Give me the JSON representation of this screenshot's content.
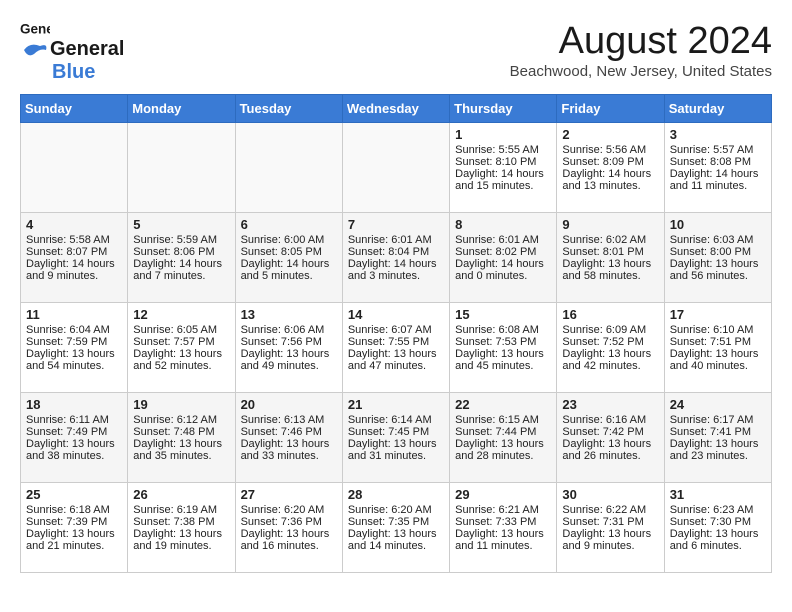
{
  "header": {
    "logo_general": "General",
    "logo_blue": "Blue",
    "month_title": "August 2024",
    "location": "Beachwood, New Jersey, United States"
  },
  "days_of_week": [
    "Sunday",
    "Monday",
    "Tuesday",
    "Wednesday",
    "Thursday",
    "Friday",
    "Saturday"
  ],
  "weeks": [
    [
      {
        "day": "",
        "content": ""
      },
      {
        "day": "",
        "content": ""
      },
      {
        "day": "",
        "content": ""
      },
      {
        "day": "",
        "content": ""
      },
      {
        "day": "1",
        "content": "Sunrise: 5:55 AM\nSunset: 8:10 PM\nDaylight: 14 hours\nand 15 minutes."
      },
      {
        "day": "2",
        "content": "Sunrise: 5:56 AM\nSunset: 8:09 PM\nDaylight: 14 hours\nand 13 minutes."
      },
      {
        "day": "3",
        "content": "Sunrise: 5:57 AM\nSunset: 8:08 PM\nDaylight: 14 hours\nand 11 minutes."
      }
    ],
    [
      {
        "day": "4",
        "content": "Sunrise: 5:58 AM\nSunset: 8:07 PM\nDaylight: 14 hours\nand 9 minutes."
      },
      {
        "day": "5",
        "content": "Sunrise: 5:59 AM\nSunset: 8:06 PM\nDaylight: 14 hours\nand 7 minutes."
      },
      {
        "day": "6",
        "content": "Sunrise: 6:00 AM\nSunset: 8:05 PM\nDaylight: 14 hours\nand 5 minutes."
      },
      {
        "day": "7",
        "content": "Sunrise: 6:01 AM\nSunset: 8:04 PM\nDaylight: 14 hours\nand 3 minutes."
      },
      {
        "day": "8",
        "content": "Sunrise: 6:01 AM\nSunset: 8:02 PM\nDaylight: 14 hours\nand 0 minutes."
      },
      {
        "day": "9",
        "content": "Sunrise: 6:02 AM\nSunset: 8:01 PM\nDaylight: 13 hours\nand 58 minutes."
      },
      {
        "day": "10",
        "content": "Sunrise: 6:03 AM\nSunset: 8:00 PM\nDaylight: 13 hours\nand 56 minutes."
      }
    ],
    [
      {
        "day": "11",
        "content": "Sunrise: 6:04 AM\nSunset: 7:59 PM\nDaylight: 13 hours\nand 54 minutes."
      },
      {
        "day": "12",
        "content": "Sunrise: 6:05 AM\nSunset: 7:57 PM\nDaylight: 13 hours\nand 52 minutes."
      },
      {
        "day": "13",
        "content": "Sunrise: 6:06 AM\nSunset: 7:56 PM\nDaylight: 13 hours\nand 49 minutes."
      },
      {
        "day": "14",
        "content": "Sunrise: 6:07 AM\nSunset: 7:55 PM\nDaylight: 13 hours\nand 47 minutes."
      },
      {
        "day": "15",
        "content": "Sunrise: 6:08 AM\nSunset: 7:53 PM\nDaylight: 13 hours\nand 45 minutes."
      },
      {
        "day": "16",
        "content": "Sunrise: 6:09 AM\nSunset: 7:52 PM\nDaylight: 13 hours\nand 42 minutes."
      },
      {
        "day": "17",
        "content": "Sunrise: 6:10 AM\nSunset: 7:51 PM\nDaylight: 13 hours\nand 40 minutes."
      }
    ],
    [
      {
        "day": "18",
        "content": "Sunrise: 6:11 AM\nSunset: 7:49 PM\nDaylight: 13 hours\nand 38 minutes."
      },
      {
        "day": "19",
        "content": "Sunrise: 6:12 AM\nSunset: 7:48 PM\nDaylight: 13 hours\nand 35 minutes."
      },
      {
        "day": "20",
        "content": "Sunrise: 6:13 AM\nSunset: 7:46 PM\nDaylight: 13 hours\nand 33 minutes."
      },
      {
        "day": "21",
        "content": "Sunrise: 6:14 AM\nSunset: 7:45 PM\nDaylight: 13 hours\nand 31 minutes."
      },
      {
        "day": "22",
        "content": "Sunrise: 6:15 AM\nSunset: 7:44 PM\nDaylight: 13 hours\nand 28 minutes."
      },
      {
        "day": "23",
        "content": "Sunrise: 6:16 AM\nSunset: 7:42 PM\nDaylight: 13 hours\nand 26 minutes."
      },
      {
        "day": "24",
        "content": "Sunrise: 6:17 AM\nSunset: 7:41 PM\nDaylight: 13 hours\nand 23 minutes."
      }
    ],
    [
      {
        "day": "25",
        "content": "Sunrise: 6:18 AM\nSunset: 7:39 PM\nDaylight: 13 hours\nand 21 minutes."
      },
      {
        "day": "26",
        "content": "Sunrise: 6:19 AM\nSunset: 7:38 PM\nDaylight: 13 hours\nand 19 minutes."
      },
      {
        "day": "27",
        "content": "Sunrise: 6:20 AM\nSunset: 7:36 PM\nDaylight: 13 hours\nand 16 minutes."
      },
      {
        "day": "28",
        "content": "Sunrise: 6:20 AM\nSunset: 7:35 PM\nDaylight: 13 hours\nand 14 minutes."
      },
      {
        "day": "29",
        "content": "Sunrise: 6:21 AM\nSunset: 7:33 PM\nDaylight: 13 hours\nand 11 minutes."
      },
      {
        "day": "30",
        "content": "Sunrise: 6:22 AM\nSunset: 7:31 PM\nDaylight: 13 hours\nand 9 minutes."
      },
      {
        "day": "31",
        "content": "Sunrise: 6:23 AM\nSunset: 7:30 PM\nDaylight: 13 hours\nand 6 minutes."
      }
    ]
  ]
}
